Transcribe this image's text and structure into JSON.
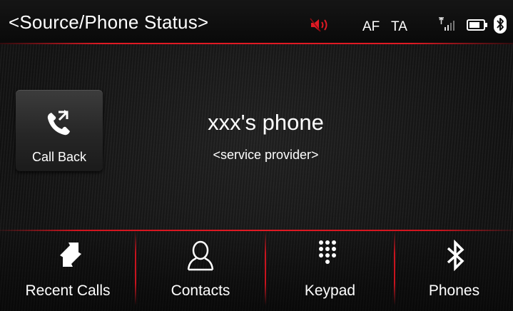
{
  "status_bar": {
    "title": "<Source/Phone Status>",
    "af_label": "AF",
    "ta_label": "TA",
    "icons": [
      "speaker-muted-icon",
      "signal-icon",
      "battery-icon",
      "bluetooth-icon"
    ]
  },
  "call_back": {
    "label": "Call Back",
    "icon": "phone-callback-icon"
  },
  "phone": {
    "name": "xxx's phone",
    "provider": "<service provider>"
  },
  "nav": {
    "items": [
      {
        "label": "Recent Calls",
        "icon": "recent-calls-icon"
      },
      {
        "label": "Contacts",
        "icon": "contacts-icon"
      },
      {
        "label": "Keypad",
        "icon": "keypad-icon"
      },
      {
        "label": "Phones",
        "icon": "bluetooth-icon"
      }
    ]
  },
  "colors": {
    "accent_red": "#e01a24",
    "background": "#141414",
    "text": "#ffffff"
  }
}
